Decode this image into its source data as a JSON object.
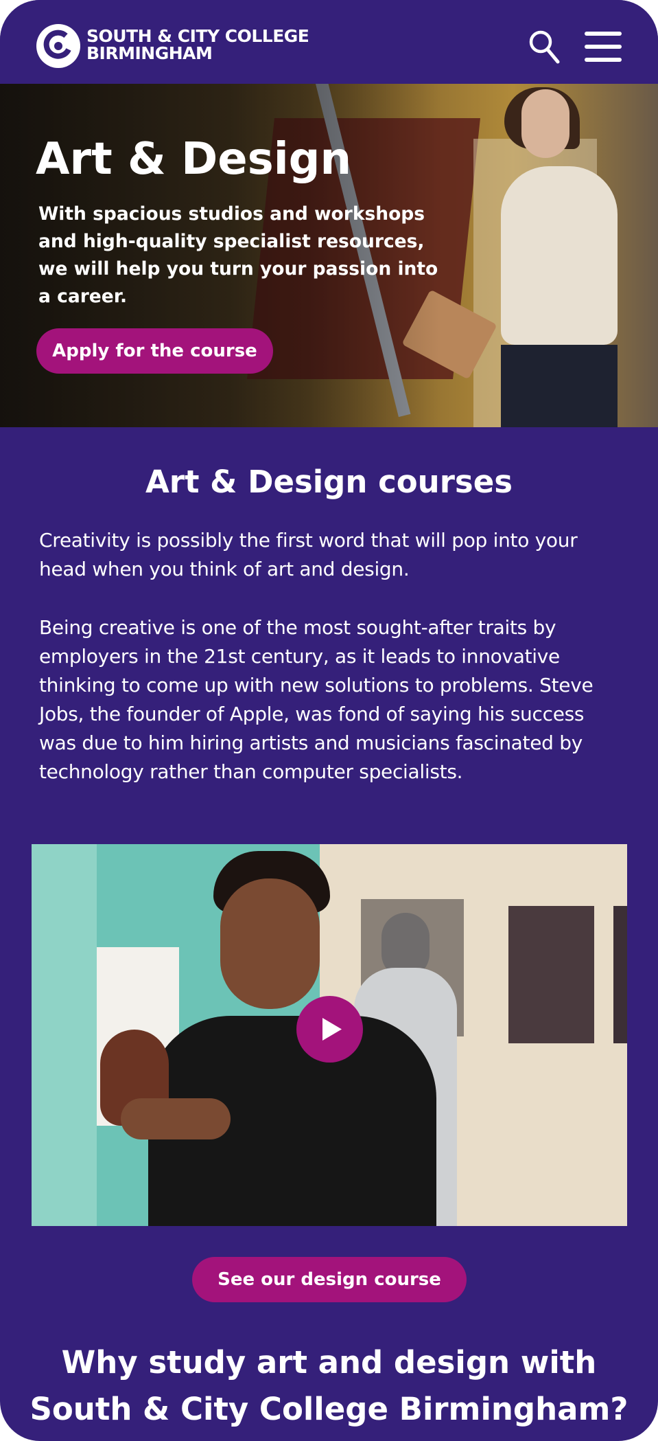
{
  "header": {
    "logo_line1": "SOUTH & CITY COLLEGE",
    "logo_line2": "BIRMINGHAM",
    "search_icon": "search-icon",
    "menu_icon": "hamburger-menu-icon"
  },
  "hero": {
    "title": "Art & Design",
    "subtitle": "With spacious studios and workshops and high-quality specialist resources, we will help you turn your passion into a career.",
    "apply_label": "Apply for the course"
  },
  "intro": {
    "title": "Art & Design courses",
    "paragraph1": "Creativity is possibly the first word that will pop into your head when you think of art and design.",
    "paragraph2": "Being creative is one of the most sought-after traits by employers in the 21st century, as it leads to innovative thinking to come up with new solutions to problems. Steve Jobs, the founder of Apple, was fond of saying his success was due to him hiring artists and musicians fascinated by technology rather than computer specialists."
  },
  "video": {
    "play_icon": "play-icon"
  },
  "cta": {
    "see_label": "See our design course"
  },
  "why": {
    "line1": "Why study art and design with",
    "line2": "South & City College Birmingham?"
  },
  "colors": {
    "background": "#35207a",
    "accent": "#a3137b",
    "text": "#ffffff"
  }
}
